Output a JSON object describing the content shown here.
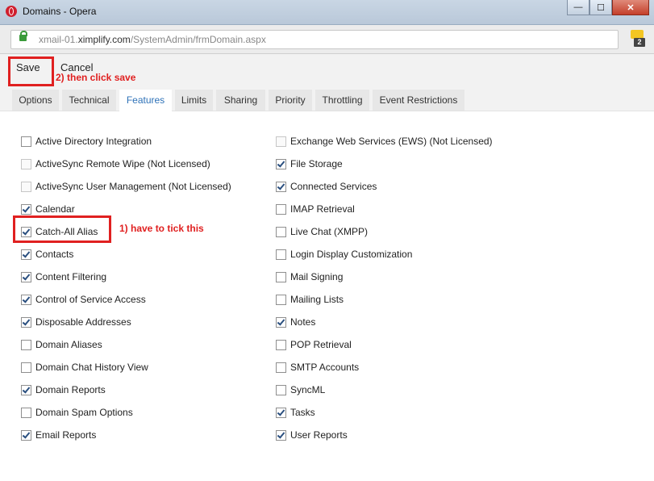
{
  "window": {
    "title": "Domains - Opera",
    "controls": {
      "minimize": "—",
      "maximize": "☐",
      "close": "✕"
    }
  },
  "address": {
    "host": "xmail-01.",
    "domain": "ximplify.com",
    "path": "/SystemAdmin/frmDomain.aspx",
    "extension_badge": "2"
  },
  "toolbar": {
    "save_label": "Save",
    "cancel_label": "Cancel"
  },
  "annotations": {
    "save_note": "2) then click save",
    "tick_note": "1) have to tick this"
  },
  "tabs": [
    {
      "label": "Options",
      "active": false
    },
    {
      "label": "Technical",
      "active": false
    },
    {
      "label": "Features",
      "active": true
    },
    {
      "label": "Limits",
      "active": false
    },
    {
      "label": "Sharing",
      "active": false
    },
    {
      "label": "Priority",
      "active": false
    },
    {
      "label": "Throttling",
      "active": false
    },
    {
      "label": "Event Restrictions",
      "active": false
    }
  ],
  "features_left": [
    {
      "label": "Active Directory Integration",
      "checked": false,
      "enabled": true
    },
    {
      "label": "ActiveSync Remote Wipe (Not Licensed)",
      "checked": false,
      "enabled": false
    },
    {
      "label": "ActiveSync User Management (Not Licensed)",
      "checked": false,
      "enabled": false
    },
    {
      "label": "Calendar",
      "checked": true,
      "enabled": true
    },
    {
      "label": "Catch-All Alias",
      "checked": true,
      "enabled": true
    },
    {
      "label": "Contacts",
      "checked": true,
      "enabled": true
    },
    {
      "label": "Content Filtering",
      "checked": true,
      "enabled": true
    },
    {
      "label": "Control of Service Access",
      "checked": true,
      "enabled": true
    },
    {
      "label": "Disposable Addresses",
      "checked": true,
      "enabled": true
    },
    {
      "label": "Domain Aliases",
      "checked": false,
      "enabled": true
    },
    {
      "label": "Domain Chat History View",
      "checked": false,
      "enabled": true
    },
    {
      "label": "Domain Reports",
      "checked": true,
      "enabled": true
    },
    {
      "label": "Domain Spam Options",
      "checked": false,
      "enabled": true
    },
    {
      "label": "Email Reports",
      "checked": true,
      "enabled": true
    }
  ],
  "features_right": [
    {
      "label": "Exchange Web Services (EWS) (Not Licensed)",
      "checked": false,
      "enabled": false
    },
    {
      "label": "File Storage",
      "checked": true,
      "enabled": true
    },
    {
      "label": "Connected Services",
      "checked": true,
      "enabled": true
    },
    {
      "label": "IMAP Retrieval",
      "checked": false,
      "enabled": true
    },
    {
      "label": "Live Chat (XMPP)",
      "checked": false,
      "enabled": true
    },
    {
      "label": "Login Display Customization",
      "checked": false,
      "enabled": true
    },
    {
      "label": "Mail Signing",
      "checked": false,
      "enabled": true
    },
    {
      "label": "Mailing Lists",
      "checked": false,
      "enabled": true
    },
    {
      "label": "Notes",
      "checked": true,
      "enabled": true
    },
    {
      "label": "POP Retrieval",
      "checked": false,
      "enabled": true
    },
    {
      "label": "SMTP Accounts",
      "checked": false,
      "enabled": true
    },
    {
      "label": "SyncML",
      "checked": false,
      "enabled": true
    },
    {
      "label": "Tasks",
      "checked": true,
      "enabled": true
    },
    {
      "label": "User Reports",
      "checked": true,
      "enabled": true
    }
  ],
  "colors": {
    "annotation_red": "#e02020",
    "active_tab_text": "#2e72b8"
  }
}
